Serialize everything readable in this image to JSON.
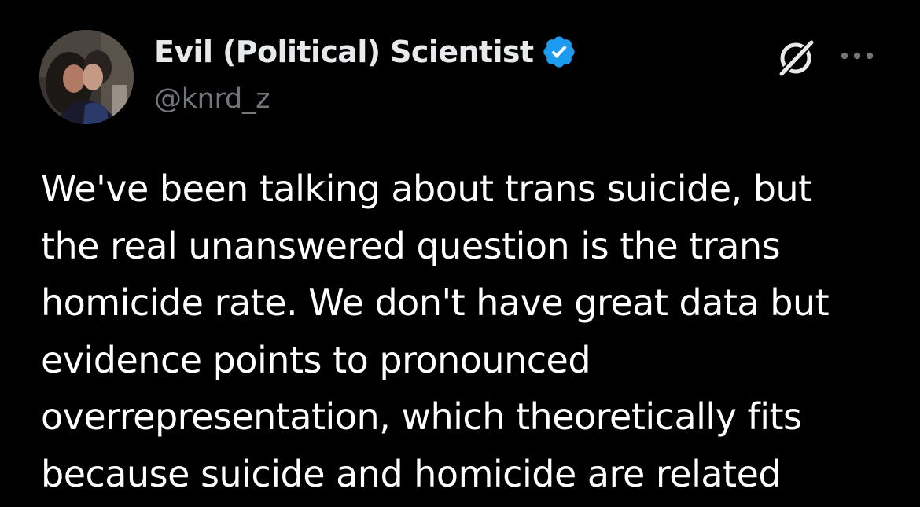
{
  "post": {
    "author": {
      "display_name": "Evil (Political) Scientist",
      "handle": "@knrd_z",
      "verified": true,
      "avatar_icon": "avatar-photo"
    },
    "actions": {
      "grok_icon": "grok-icon",
      "more_icon": "more-options-icon"
    },
    "text_lines": [
      "We've been talking about trans suicide, but",
      "the real unanswered question is the trans",
      "homicide rate. We don't have great data but",
      "evidence points to pronounced",
      "overrepresentation, which theoretically fits",
      "because suicide and homicide are related"
    ]
  },
  "colors": {
    "background": "#000000",
    "primary_text": "#e7e9ea",
    "secondary_text": "#71767b",
    "verified_badge": "#1d9bf0"
  }
}
